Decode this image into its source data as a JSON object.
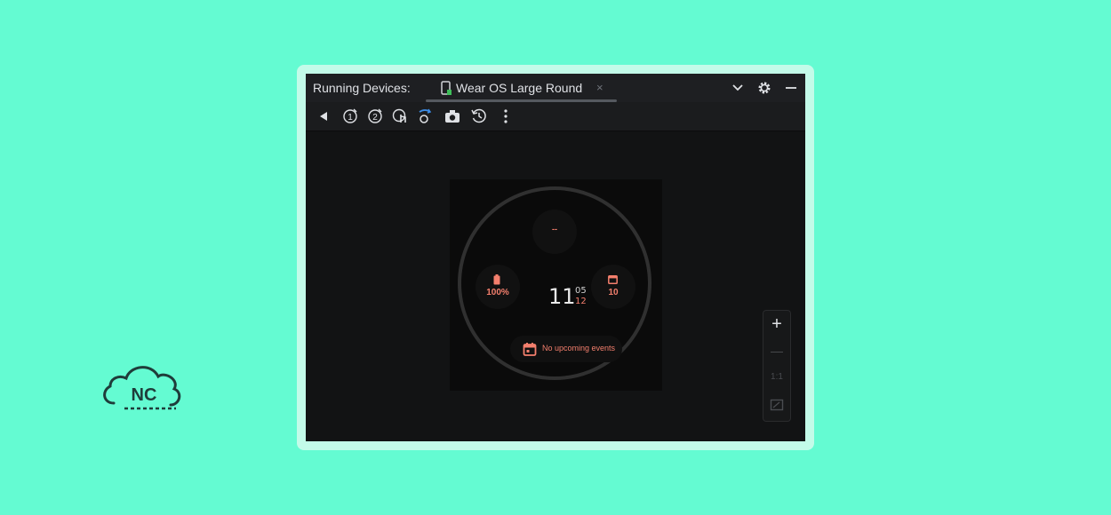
{
  "panel": {
    "label": "Running Devices:",
    "tab": {
      "title": "Wear OS Large Round",
      "close": "×"
    }
  },
  "icons": {
    "title_right": [
      "chevron-down-icon",
      "gear-icon",
      "minimize-icon"
    ],
    "toolbar": [
      "back-icon",
      "button-1-icon",
      "button-2-icon",
      "touch-icon",
      "rotate-icon",
      "camera-icon",
      "history-icon",
      "more-icon"
    ]
  },
  "watch": {
    "top_complication": "--",
    "battery": "100%",
    "date": "10",
    "hour": "11",
    "minute": "05",
    "seconds": "12",
    "event": "No upcoming events"
  },
  "zoom": {
    "zoom_in": "+",
    "zoom_out": "—",
    "actual_size": "1:1"
  },
  "colors": {
    "background": "#64fbd2",
    "accent": "#f47f6d",
    "window": "#121314"
  }
}
